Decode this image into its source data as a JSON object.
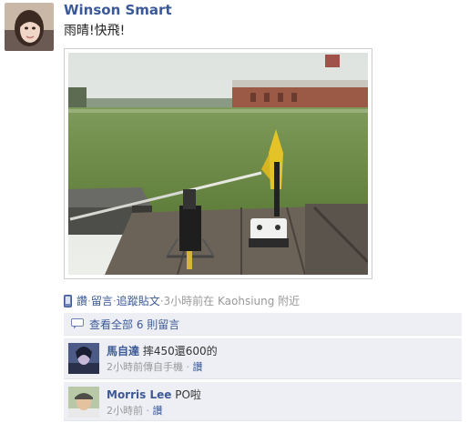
{
  "post": {
    "author": "Winson Smart",
    "status_text": "雨晴!快飛!",
    "meta": {
      "like": "讚",
      "comment": "留言",
      "follow": "追蹤貼文",
      "time_location": "3小時前在 Kaohsiung 附近",
      "separator": "·"
    }
  },
  "comments": {
    "view_all": "查看全部 6 則留言",
    "items": [
      {
        "name": "馬自達",
        "text": "摔450還600的",
        "time": "2小時前傳自手機",
        "like": "讚"
      },
      {
        "name": "Morris Lee",
        "text": "PO啦",
        "time": "2小時前",
        "like": "讚"
      }
    ]
  },
  "colors": {
    "link": "#3b5998",
    "comment_bg": "#edeff4",
    "meta_text": "#999999"
  }
}
